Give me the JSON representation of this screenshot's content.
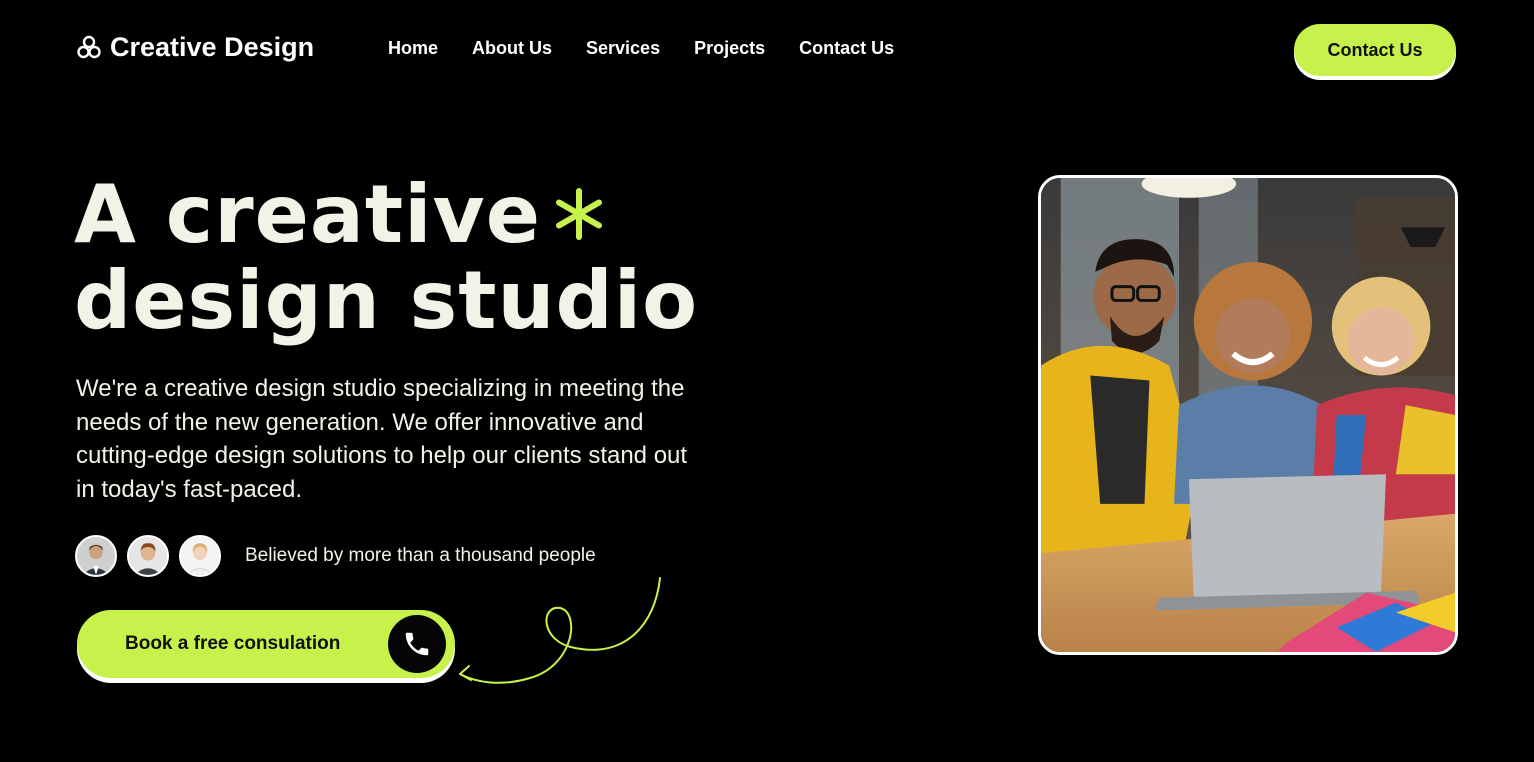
{
  "brand": {
    "name": "Creative Design",
    "accent": "#c6f24b",
    "logo_icon": "link-knot-icon"
  },
  "nav": {
    "items": [
      {
        "label": "Home"
      },
      {
        "label": "About Us"
      },
      {
        "label": "Services"
      },
      {
        "label": "Projects"
      },
      {
        "label": "Contact Us"
      }
    ]
  },
  "header": {
    "cta_label": "Contact Us"
  },
  "hero": {
    "title_line1": "A creative",
    "title_line2": "design studio",
    "title_icon": "asterisk-icon",
    "description": "We're a creative design studio specializing in meeting the needs of the new generation. We offer innovative and cutting-edge design solutions to help our clients stand out in today's fast-paced.",
    "social_proof": "Believed by more than a thousand people",
    "cta_label": "Book a free consulation",
    "cta_icon": "phone-icon",
    "image_icon": "team-photo"
  }
}
